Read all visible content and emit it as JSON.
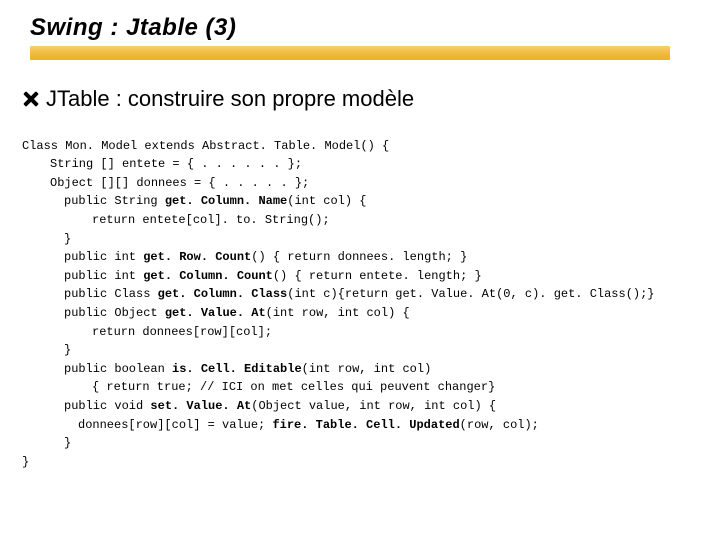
{
  "title": "Swing : Jtable (3)",
  "subtitle": "JTable : construire son propre modèle",
  "code": {
    "l0": "Class Mon. Model extends Abstract. Table. Model() {",
    "l1": "String [] entete = { . . . . . . };",
    "l2": "Object [][] donnees = { . . . . . };",
    "l3a": "public String ",
    "l3b": "get. Column. Name",
    "l3c": "(int col) {",
    "l4": "return entete[col]. to. String();",
    "l5": "}",
    "l6a": "public int ",
    "l6b": "get. Row. Count",
    "l6c": "() { return donnees. length; }",
    "l7a": "public int ",
    "l7b": "get. Column. Count",
    "l7c": "() { return entete. length; }",
    "l8a": "public Class ",
    "l8b": "get. Column. Class",
    "l8c": "(int c){return get. Value. At(0, c). get. Class();}",
    "l9a": "public Object ",
    "l9b": "get. Value. At",
    "l9c": "(int row, int col) {",
    "l10": "return donnees[row][col];",
    "l11": "}",
    "l12a": "public boolean ",
    "l12b": "is. Cell. Editable",
    "l12c": "(int row, int col)",
    "l13": "{ return true; // ICI on met celles qui peuvent changer}",
    "l14a": "public void ",
    "l14b": "set. Value. At",
    "l14c": "(Object value, int row, int col) {",
    "l15a": "donnees[row][col] = value; ",
    "l15b": "fire. Table. Cell. Updated",
    "l15c": "(row, col);",
    "l16": "}",
    "l17": "}"
  }
}
